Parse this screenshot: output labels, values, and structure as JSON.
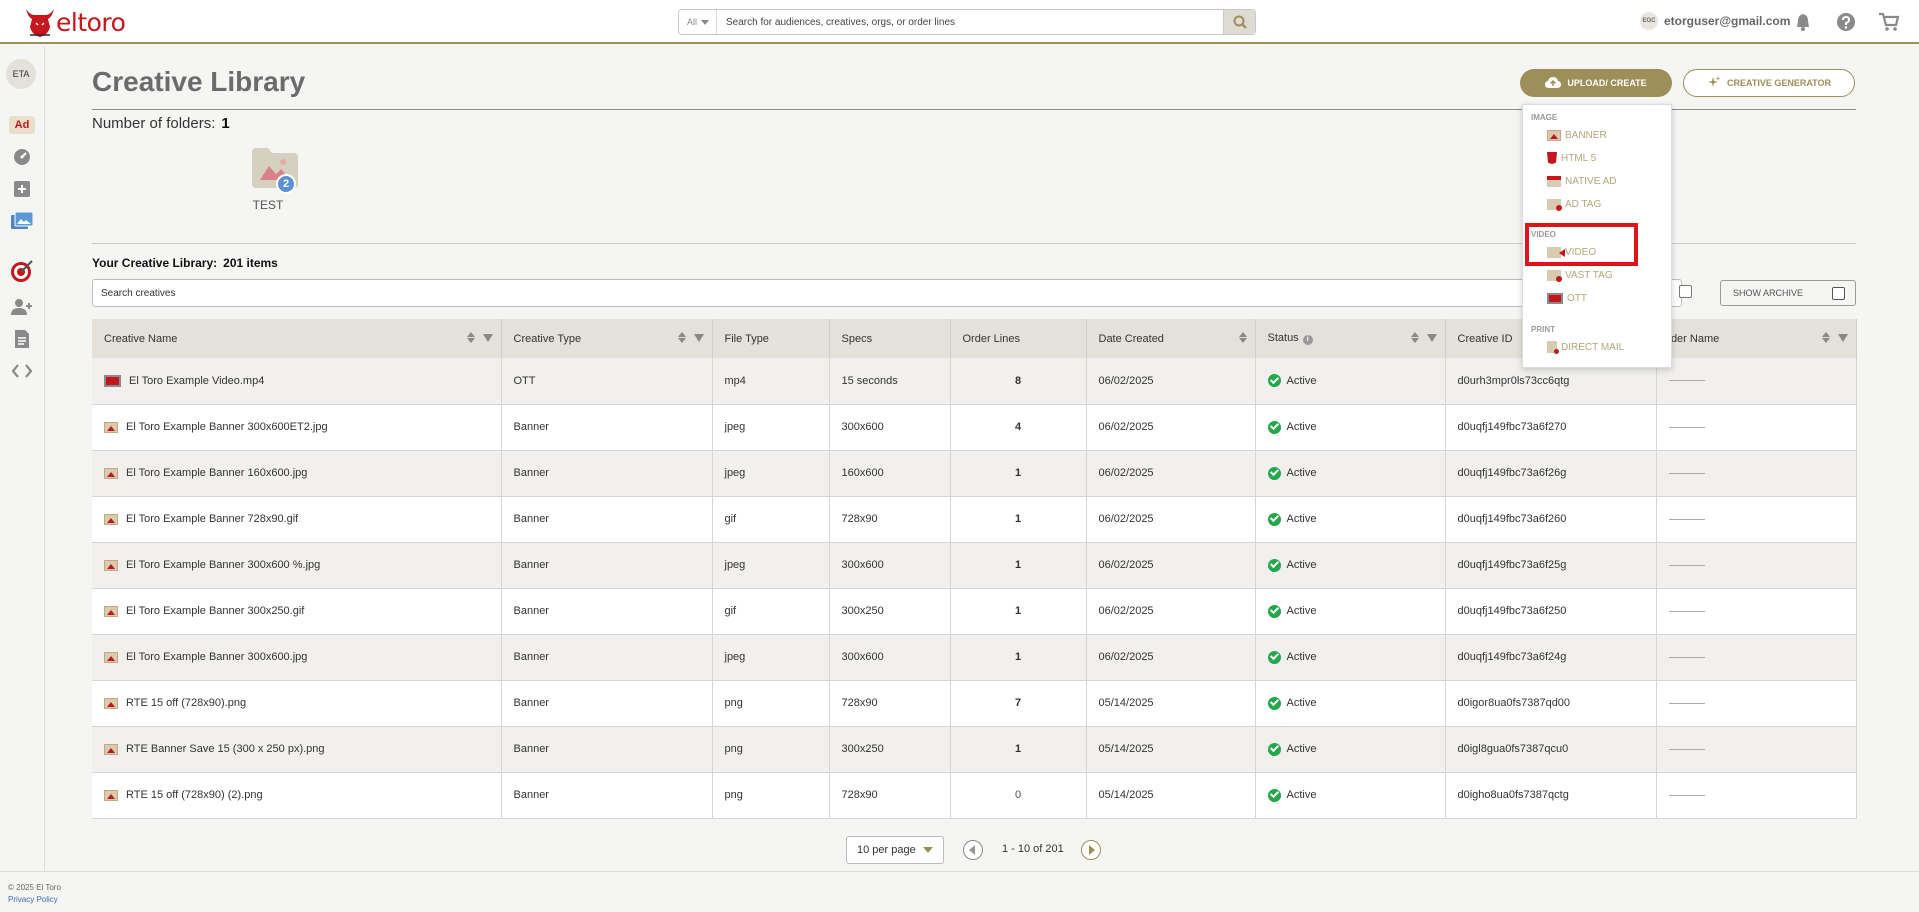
{
  "brand": {
    "name": "eltoro"
  },
  "search": {
    "scope": "All",
    "placeholder": "Search for audiences, creatives, orgs, or order lines"
  },
  "user": {
    "initials": "EGC",
    "email": "etorguser@gmail.com"
  },
  "rail": {
    "avatar": "ETA",
    "ad_label": "Ad"
  },
  "page": {
    "title": "Creative Library",
    "folder_count_label": "Number of folders:",
    "folder_count": "1",
    "folders": [
      {
        "name": "TEST",
        "count": "2"
      }
    ],
    "library_label": "Your Creative Library:",
    "library_count": "201 items",
    "search_placeholder": "Search creatives",
    "show_archive": "SHOW ARCHIVE"
  },
  "buttons": {
    "upload": "UPLOAD/ CREATE",
    "generator": "CREATIVE GENERATOR"
  },
  "dropdown": {
    "sections": [
      {
        "label": "IMAGE",
        "items": [
          {
            "label": "BANNER",
            "icon": "banner-icon"
          },
          {
            "label": "HTML 5",
            "icon": "html5-icon"
          },
          {
            "label": "NATIVE AD",
            "icon": "native-ad-icon"
          },
          {
            "label": "AD TAG",
            "icon": "ad-tag-icon"
          }
        ]
      },
      {
        "label": "VIDEO",
        "items": [
          {
            "label": "VIDEO",
            "icon": "video-icon"
          },
          {
            "label": "VAST TAG",
            "icon": "vast-tag-icon"
          },
          {
            "label": "OTT",
            "icon": "ott-icon"
          }
        ]
      },
      {
        "label": "PRINT",
        "items": [
          {
            "label": "DIRECT MAIL",
            "icon": "direct-mail-icon"
          }
        ]
      }
    ]
  },
  "table": {
    "headers": [
      "Creative Name",
      "Creative Type",
      "File Type",
      "Specs",
      "Order Lines",
      "Date Created",
      "Status",
      "Creative ID",
      "Folder Name"
    ],
    "folder_header_visible": "lder Name",
    "rows": [
      {
        "name": "El Toro Example Video.mp4",
        "type": "OTT",
        "file": "mp4",
        "specs": "15 seconds",
        "order_lines": "8",
        "date": "06/02/2025",
        "status": "Active",
        "id": "d0urh3mpr0ls73cc6qtg"
      },
      {
        "name": "El Toro Example Banner 300x600ET2.jpg",
        "type": "Banner",
        "file": "jpeg",
        "specs": "300x600",
        "order_lines": "4",
        "date": "06/02/2025",
        "status": "Active",
        "id": "d0uqfj149fbc73a6f270"
      },
      {
        "name": "El Toro Example Banner 160x600.jpg",
        "type": "Banner",
        "file": "jpeg",
        "specs": "160x600",
        "order_lines": "1",
        "date": "06/02/2025",
        "status": "Active",
        "id": "d0uqfj149fbc73a6f26g"
      },
      {
        "name": "El Toro Example Banner 728x90.gif",
        "type": "Banner",
        "file": "gif",
        "specs": "728x90",
        "order_lines": "1",
        "date": "06/02/2025",
        "status": "Active",
        "id": "d0uqfj149fbc73a6f260"
      },
      {
        "name": "El Toro Example Banner 300x600 %.jpg",
        "type": "Banner",
        "file": "jpeg",
        "specs": "300x600",
        "order_lines": "1",
        "date": "06/02/2025",
        "status": "Active",
        "id": "d0uqfj149fbc73a6f25g"
      },
      {
        "name": "El Toro Example Banner 300x250.gif",
        "type": "Banner",
        "file": "gif",
        "specs": "300x250",
        "order_lines": "1",
        "date": "06/02/2025",
        "status": "Active",
        "id": "d0uqfj149fbc73a6f250"
      },
      {
        "name": "El Toro Example Banner 300x600.jpg",
        "type": "Banner",
        "file": "jpeg",
        "specs": "300x600",
        "order_lines": "1",
        "date": "06/02/2025",
        "status": "Active",
        "id": "d0uqfj149fbc73a6f24g"
      },
      {
        "name": "RTE 15 off (728x90).png",
        "type": "Banner",
        "file": "png",
        "specs": "728x90",
        "order_lines": "7",
        "date": "05/14/2025",
        "status": "Active",
        "id": "d0igor8ua0fs7387qd00"
      },
      {
        "name": "RTE Banner Save 15 (300 x 250 px).png",
        "type": "Banner",
        "file": "png",
        "specs": "300x250",
        "order_lines": "1",
        "date": "05/14/2025",
        "status": "Active",
        "id": "d0igl8gua0fs7387qcu0"
      },
      {
        "name": "RTE 15 off (728x90) (2).png",
        "type": "Banner",
        "file": "png",
        "specs": "728x90",
        "order_lines": "0",
        "date": "05/14/2025",
        "status": "Active",
        "id": "d0igho8ua0fs7387qctg"
      }
    ]
  },
  "pagination": {
    "per_page": "10 per page",
    "range": "1 - 10 of 201"
  },
  "footer": {
    "copyright": "© 2025 El Toro",
    "privacy": "Privacy Policy"
  },
  "colors": {
    "accent": "#9c8f5a",
    "brand_red": "#c4161c",
    "active_green": "#22a84a",
    "link_blue": "#3b6eb5"
  }
}
